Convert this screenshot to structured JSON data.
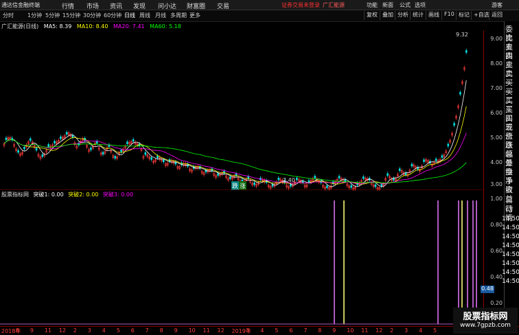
{
  "menu": {
    "logo": "通达信金融终端",
    "items": [
      "行情",
      "市场",
      "资讯",
      "发现",
      "问小达",
      "财富圈",
      "交易"
    ],
    "warning": "证券交易未登录",
    "stock": "广汇能源",
    "right": [
      "功能",
      "新面",
      "公式",
      "选项"
    ],
    "user": "游客"
  },
  "toolbar": {
    "periods": [
      "分时",
      "1分钟",
      "5分钟",
      "15分钟",
      "30分钟",
      "60分钟",
      "日线",
      "周线",
      "月线",
      "多周期",
      "更多"
    ],
    "active": "日线",
    "buttons": [
      "复权",
      "叠加",
      "分析",
      "统计",
      "画线",
      "F10",
      "标记",
      "+自选",
      "返回"
    ]
  },
  "info": {
    "title": "广汇能源(日线)",
    "ma5": "MA5: 8.39",
    "ma10": "MA10: 8.40",
    "ma20": "MA20: 7.41",
    "ma60": "MA60: 5.18"
  },
  "price_labels": {
    "high": "9.32",
    "low": "2.40"
  },
  "signals": {
    "up": "涨",
    "down": "跌"
  },
  "yaxis": [
    "9.00",
    "8.00",
    "7.00",
    "6.00",
    "5.00",
    "4.00",
    "3.00"
  ],
  "ind": {
    "name": "股票指标网",
    "t1": "突破1: 0.00",
    "t2": "突破2: 0.00",
    "t3": "突破3: 0.00",
    "yaxis": [
      "1.00",
      "0.80",
      "0.60",
      "0.40",
      "0.20"
    ],
    "current": "0.48"
  },
  "side": [
    "委比",
    "卖五",
    "卖四",
    "卖三",
    "卖二",
    "卖一",
    "买一",
    "买二",
    "买三",
    "买四",
    "买五",
    "现价",
    "涨跌",
    "涨幅",
    "总量",
    "外盘",
    "换手",
    "净资",
    "收益"
  ],
  "side2": [
    "自动",
    "行情"
  ],
  "times": [
    "14:50",
    "14:50",
    "14:50",
    "14:50",
    "14:50",
    "14:50",
    "14:50",
    "14:50"
  ],
  "xaxis": [
    "2018年",
    "8",
    "9",
    "11",
    "12",
    "2",
    "3",
    "4",
    "5",
    "6",
    "7",
    "8",
    "9",
    "10",
    "11",
    "12",
    "2019年",
    "3",
    "4",
    "5",
    "6",
    "7",
    "8",
    "9",
    "10",
    "11",
    "12",
    "2",
    "3",
    "4",
    "5"
  ],
  "watermark": {
    "line1": "股票指标网",
    "line2": "www.7gpzb.com"
  },
  "colors": {
    "up": "#ff3b3b",
    "down": "#00e0e0",
    "ma5": "#ffffff",
    "ma10": "#ffff00",
    "ma20": "#ff00ff",
    "ma60": "#00ff00",
    "bar": "#b05ac0"
  }
}
